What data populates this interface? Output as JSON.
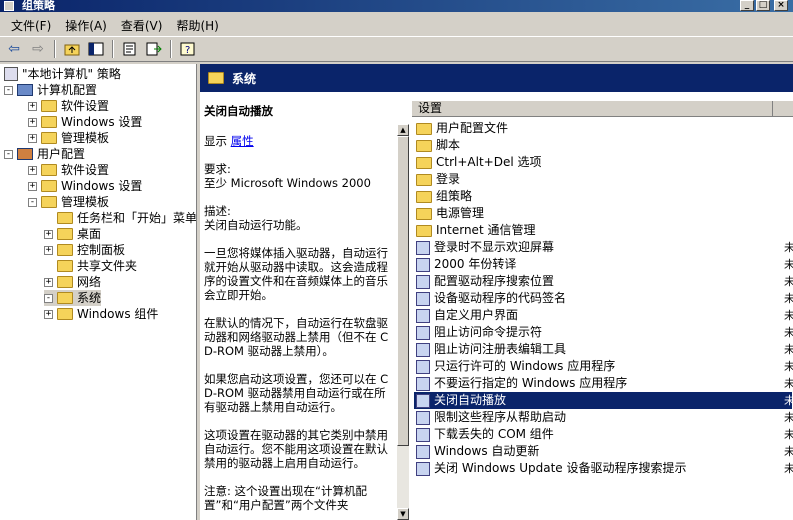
{
  "window": {
    "title": "组策略"
  },
  "menu": [
    "文件(F)",
    "操作(A)",
    "查看(V)",
    "帮助(H)"
  ],
  "toolbar": {
    "icons": [
      "back-arrow-icon",
      "forward-arrow-icon",
      "up-folder-icon",
      "show-hide-tree-icon",
      "properties-icon",
      "export-list-icon",
      "help-icon"
    ]
  },
  "tree": {
    "root": "\"本地计算机\" 策略",
    "items": [
      {
        "label": "计算机配置",
        "level": 1,
        "expander": "-",
        "icon": "computer-icon"
      },
      {
        "label": "软件设置",
        "level": 2,
        "expander": "+",
        "icon": "folder-icon"
      },
      {
        "label": "Windows 设置",
        "level": 2,
        "expander": "+",
        "icon": "folder-icon"
      },
      {
        "label": "管理模板",
        "level": 2,
        "expander": "+",
        "icon": "folder-icon"
      },
      {
        "label": "用户配置",
        "level": 1,
        "expander": "-",
        "icon": "user-icon"
      },
      {
        "label": "软件设置",
        "level": 2,
        "expander": "+",
        "icon": "folder-icon"
      },
      {
        "label": "Windows 设置",
        "level": 2,
        "expander": "+",
        "icon": "folder-icon"
      },
      {
        "label": "管理模板",
        "level": 2,
        "expander": "-",
        "icon": "folder-icon"
      },
      {
        "label": "任务栏和「开始」菜单",
        "level": 3,
        "expander": "",
        "icon": "folder-icon"
      },
      {
        "label": "桌面",
        "level": 3,
        "expander": "+",
        "icon": "folder-icon"
      },
      {
        "label": "控制面板",
        "level": 3,
        "expander": "+",
        "icon": "folder-icon"
      },
      {
        "label": "共享文件夹",
        "level": 3,
        "expander": "",
        "icon": "folder-icon"
      },
      {
        "label": "网络",
        "level": 3,
        "expander": "+",
        "icon": "folder-icon"
      },
      {
        "label": "系统",
        "level": 3,
        "expander": "-",
        "icon": "folder-icon",
        "selected": true
      },
      {
        "label": "Windows 组件",
        "level": 3,
        "expander": "+",
        "icon": "folder-icon"
      }
    ]
  },
  "header": {
    "title": "系统"
  },
  "description": {
    "title": "关闭自动播放",
    "show_label": "显示",
    "properties_link": "属性",
    "req_label": "要求:",
    "req_value": "至少 Microsoft Windows 2000",
    "desc_label": "描述:",
    "desc_value": "关闭自动运行功能。",
    "para1": "一旦您将媒体插入驱动器，自动运行就开始从驱动器中读取。这会造成程序的设置文件和在音频媒体上的音乐会立即开始。",
    "para2": "在默认的情况下，自动运行在软盘驱动器和网络驱动器上禁用（但不在 CD-ROM 驱动器上禁用）。",
    "para3": "如果您启动这项设置，您还可以在 CD-ROM 驱动器禁用自动运行或在所有驱动器上禁用自动运行。",
    "para4": "这项设置在驱动器的其它类别中禁用自动运行。您不能用这项设置在默认禁用的驱动器上启用自动运行。",
    "para5": "注意: 这个设置出现在“计算机配置”和“用户配置”两个文件夹"
  },
  "list": {
    "column_setting": "设置",
    "rows": [
      {
        "label": "用户配置文件",
        "type": "folder"
      },
      {
        "label": "脚本",
        "type": "folder"
      },
      {
        "label": "Ctrl+Alt+Del 选项",
        "type": "folder"
      },
      {
        "label": "登录",
        "type": "folder"
      },
      {
        "label": "组策略",
        "type": "folder"
      },
      {
        "label": "电源管理",
        "type": "folder"
      },
      {
        "label": "Internet 通信管理",
        "type": "folder"
      },
      {
        "label": "登录时不显示欢迎屏幕",
        "type": "setting",
        "state": "未"
      },
      {
        "label": "2000 年份转译",
        "type": "setting",
        "state": "未"
      },
      {
        "label": "配置驱动程序搜索位置",
        "type": "setting",
        "state": "未"
      },
      {
        "label": "设备驱动程序的代码签名",
        "type": "setting",
        "state": "未"
      },
      {
        "label": "自定义用户界面",
        "type": "setting",
        "state": "未"
      },
      {
        "label": "阻止访问命令提示符",
        "type": "setting",
        "state": "未"
      },
      {
        "label": "阻止访问注册表编辑工具",
        "type": "setting",
        "state": "未"
      },
      {
        "label": "只运行许可的 Windows 应用程序",
        "type": "setting",
        "state": "未"
      },
      {
        "label": "不要运行指定的 Windows 应用程序",
        "type": "setting",
        "state": "未"
      },
      {
        "label": "关闭自动播放",
        "type": "setting",
        "state": "未",
        "selected": true
      },
      {
        "label": "限制这些程序从帮助启动",
        "type": "setting",
        "state": "未"
      },
      {
        "label": "下载丢失的 COM 组件",
        "type": "setting",
        "state": "未"
      },
      {
        "label": "Windows 自动更新",
        "type": "setting",
        "state": "未"
      },
      {
        "label": "关闭 Windows Update 设备驱动程序搜索提示",
        "type": "setting",
        "state": "未"
      }
    ]
  }
}
